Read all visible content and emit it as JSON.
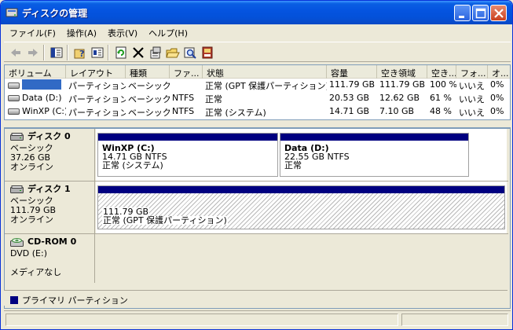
{
  "window": {
    "title": "ディスクの管理"
  },
  "menu": [
    "ファイル(F)",
    "操作(A)",
    "表示(V)",
    "ヘルプ(H)"
  ],
  "toolbar": [
    "back-icon",
    "forward-icon",
    "console-tree-icon",
    "help-icon",
    "properties-list-icon",
    "refresh-icon",
    "delete-icon",
    "properties-icon",
    "open-icon",
    "explore-icon",
    "help-topics-icon"
  ],
  "list": {
    "columns": [
      "ボリューム",
      "レイアウト",
      "種類",
      "ファ...",
      "状態",
      "容量",
      "空き領域",
      "空き...",
      "フォ...",
      "オ..."
    ],
    "rows": [
      {
        "volume": "",
        "layout": "パーティション",
        "type": "ベーシック",
        "fs": "",
        "status": "正常 (GPT 保護パーティション)",
        "capacity": "111.79 GB",
        "free": "111.79 GB",
        "free_pct": "100 %",
        "fault": "いいえ",
        "overhead": "0%"
      },
      {
        "volume": "Data (D:)",
        "layout": "パーティション",
        "type": "ベーシック",
        "fs": "NTFS",
        "status": "正常",
        "capacity": "20.53 GB",
        "free": "12.62 GB",
        "free_pct": "61 %",
        "fault": "いいえ",
        "overhead": "0%"
      },
      {
        "volume": "WinXP (C:)",
        "layout": "パーティション",
        "type": "ベーシック",
        "fs": "NTFS",
        "status": "正常 (システム)",
        "capacity": "14.71 GB",
        "free": "7.10 GB",
        "free_pct": "48 %",
        "fault": "いいえ",
        "overhead": "0%"
      }
    ]
  },
  "disks": [
    {
      "name": "ディスク 0",
      "type": "ベーシック",
      "size": "37.26 GB",
      "state": "オンライン",
      "partitions": [
        {
          "title": "WinXP  (C:)",
          "size": "14.71 GB NTFS",
          "status": "正常 (システム)"
        },
        {
          "title": "Data  (D:)",
          "size": "22.55 GB NTFS",
          "status": "正常"
        }
      ]
    },
    {
      "name": "ディスク 1",
      "type": "ベーシック",
      "size": "111.79 GB",
      "state": "オンライン",
      "partitions": [
        {
          "title": "",
          "size": "111.79 GB",
          "status": "正常 (GPT 保護パーティション)"
        }
      ]
    },
    {
      "name": "CD-ROM 0",
      "type": "DVD (E:)",
      "size": "",
      "state": "メディアなし",
      "partitions": []
    }
  ],
  "legend": {
    "label": "プライマリ パーティション",
    "color": "#000080"
  },
  "colors": {
    "titlebar": "#0554e0",
    "selection": "#316ac5",
    "partition_header": "#000080"
  }
}
